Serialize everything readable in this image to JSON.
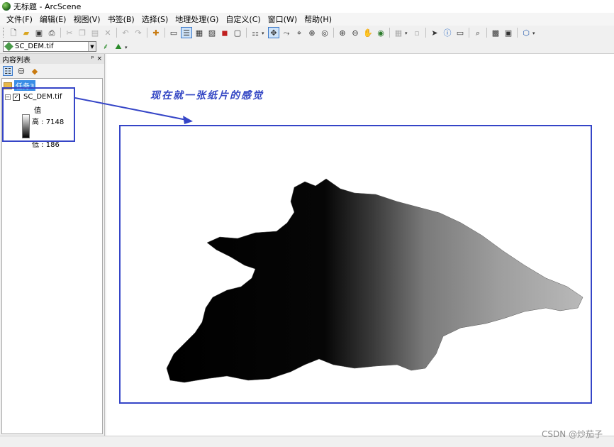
{
  "window": {
    "title": "无标题 - ArcScene"
  },
  "menubar": {
    "items": [
      "文件(F)",
      "编辑(E)",
      "视图(V)",
      "书签(B)",
      "选择(S)",
      "地理处理(G)",
      "自定义(C)",
      "窗口(W)",
      "帮助(H)"
    ]
  },
  "layer_selector": {
    "value": "SC_DEM.tif"
  },
  "toc": {
    "title": "内容列表",
    "pin": "ᵖ",
    "close": "×",
    "scene_name": "任务3",
    "layer": {
      "name": "SC_DEM.tif",
      "checked": "✓",
      "expander": "−",
      "legend_title": "值",
      "high_label": "高 : 7148",
      "low_label": "低 : 186"
    }
  },
  "annotation": {
    "text": "现在就一张纸片的感觉"
  },
  "watermark": {
    "text": "CSDN @炒茄子"
  },
  "colors": {
    "accent_blue": "#3545c7",
    "selection_blue": "#3a8ee6"
  }
}
